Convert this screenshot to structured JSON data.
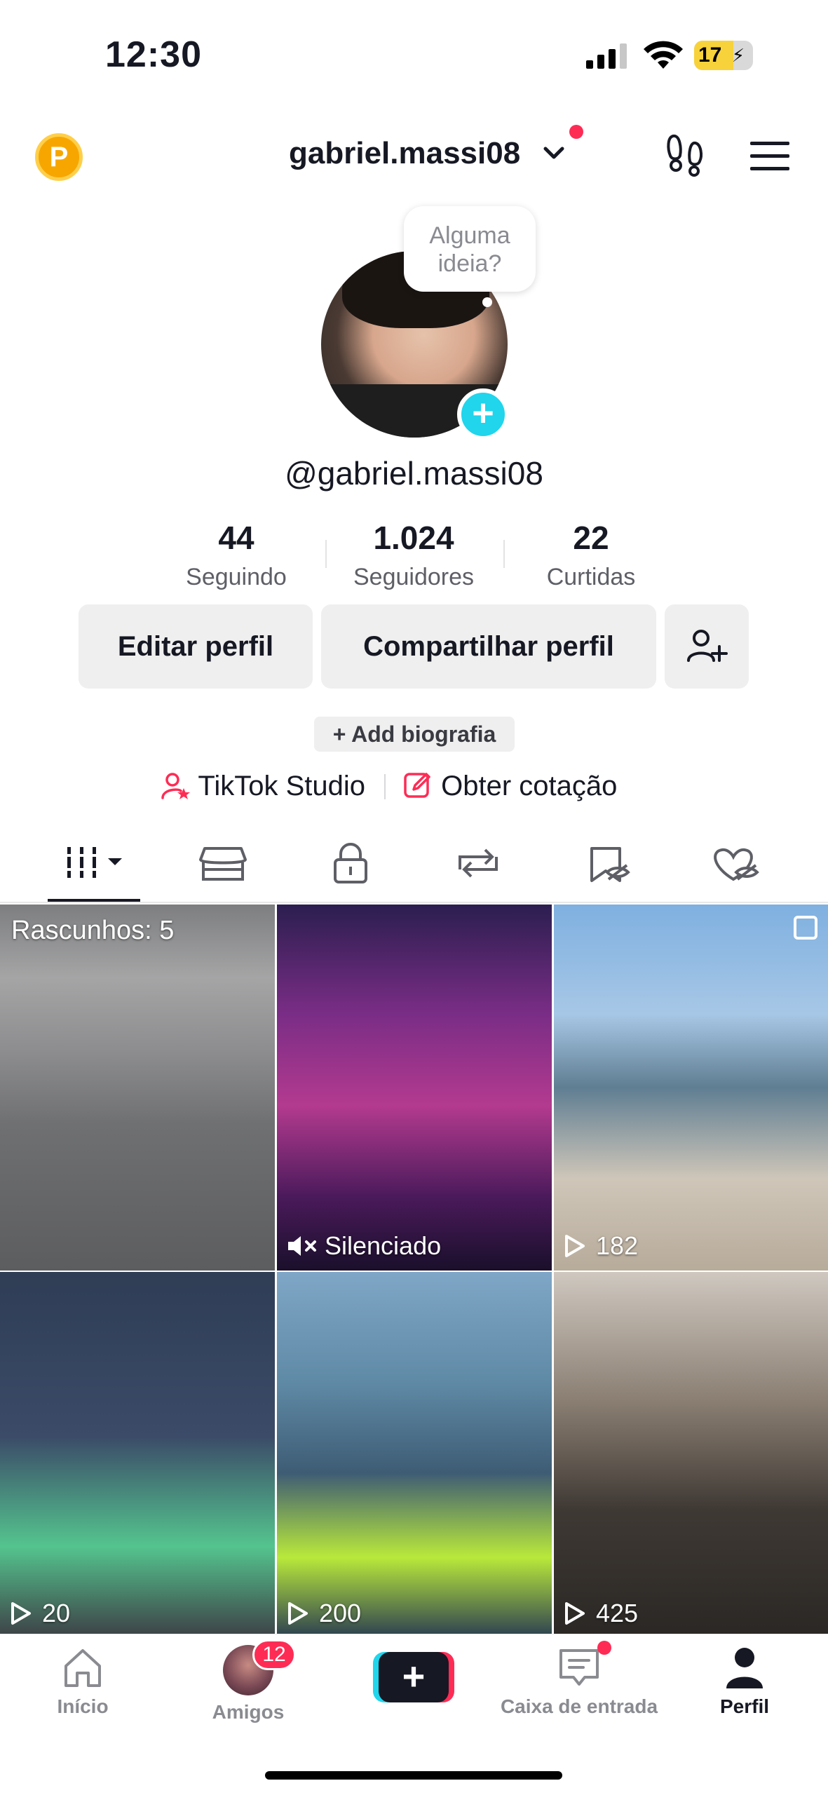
{
  "status_bar": {
    "time": "12:30",
    "battery_percent": "17",
    "battery_level": 0.17,
    "battery_color": "#f7d23b"
  },
  "header": {
    "coin_letter": "P",
    "username": "gabriel.massi08",
    "icons": [
      "coin-icon",
      "chevron-down-icon",
      "footprints-icon",
      "menu-icon"
    ],
    "notification_dot_color": "#fe2c55"
  },
  "profile": {
    "thought_bubble": "Alguma\nideia?",
    "thought_line1": "Alguma",
    "thought_line2": "ideia?",
    "handle": "@gabriel.massi08",
    "stats": [
      {
        "value": "44",
        "label": "Seguindo"
      },
      {
        "value": "1.024",
        "label": "Seguidores"
      },
      {
        "value": "22",
        "label": "Curtidas"
      }
    ],
    "edit_button": "Editar perfil",
    "share_button": "Compartilhar perfil",
    "add_bio": "+ Add biografia",
    "studio_link": "TikTok Studio",
    "quote_link": "Obter cotação",
    "accent_color": "#fe2c55"
  },
  "tabs": {
    "items": [
      "videos-grid-tab",
      "shop-tab",
      "private-tab",
      "reposts-tab",
      "favorites-tab",
      "liked-tab"
    ],
    "active": "videos-grid-tab"
  },
  "grid": {
    "drafts_label": "Rascunhos: 5",
    "items": [
      {
        "label": ""
      },
      {
        "label": "Silenciado"
      },
      {
        "label": "182"
      },
      {
        "label": "20"
      },
      {
        "label": "200"
      },
      {
        "label": "425"
      }
    ]
  },
  "bottom_nav": {
    "items": [
      {
        "label": "Início"
      },
      {
        "label": "Amigos",
        "badge": "12"
      },
      {
        "label": ""
      },
      {
        "label": "Caixa de entrada"
      },
      {
        "label": "Perfil"
      }
    ],
    "active": "Perfil"
  }
}
